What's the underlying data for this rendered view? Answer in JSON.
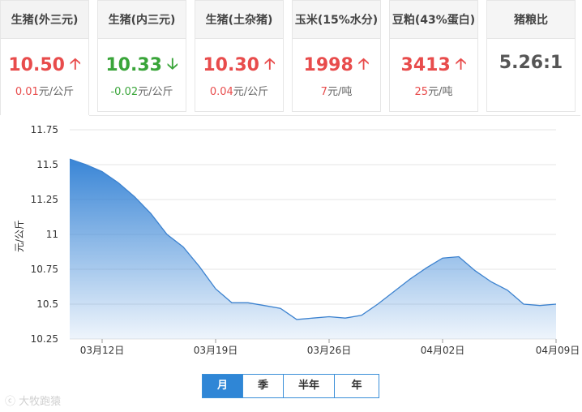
{
  "cards": [
    {
      "title": "生猪(外三元)",
      "price": "10.50",
      "direction": "up",
      "change_value": "0.01",
      "change_unit": "元/公斤"
    },
    {
      "title": "生猪(内三元)",
      "price": "10.33",
      "direction": "down",
      "change_value": "-0.02",
      "change_unit": "元/公斤"
    },
    {
      "title": "生猪(土杂猪)",
      "price": "10.30",
      "direction": "up",
      "change_value": "0.04",
      "change_unit": "元/公斤"
    },
    {
      "title": "玉米(15%水分)",
      "price": "1998",
      "direction": "up",
      "change_value": "7",
      "change_unit": "元/吨"
    },
    {
      "title": "豆粕(43%蛋白)",
      "price": "3413",
      "direction": "up",
      "change_value": "25",
      "change_unit": "元/吨"
    },
    {
      "title": "猪粮比",
      "price": "5.26:1",
      "direction": "none",
      "change_value": "",
      "change_unit": ""
    }
  ],
  "colors": {
    "up": "#e84c4c",
    "down": "#3aa53a",
    "area_top": "#2f7fd4",
    "line": "#3c82cf"
  },
  "icons": {
    "up": "arrow-up-icon",
    "down": "arrow-down-icon"
  },
  "chart_data": {
    "type": "area",
    "ylabel": "元/公斤",
    "ylim": [
      10.25,
      11.75
    ],
    "yticks": [
      "10.25",
      "10.5",
      "10.75",
      "11",
      "11.25",
      "11.5",
      "11.75"
    ],
    "x_tick_labels": [
      "03月12日",
      "03月19日",
      "03月26日",
      "04月02日",
      "04月09日"
    ],
    "x_tick_days": [
      2,
      9,
      16,
      23,
      30
    ],
    "x_range_days": [
      0,
      30
    ],
    "grid": "horizontal",
    "series": [
      {
        "days": [
          0,
          1,
          2,
          3,
          4,
          5,
          6,
          7,
          8,
          9,
          10,
          11,
          12,
          13,
          14,
          15,
          16,
          17,
          18,
          19,
          20,
          21,
          22,
          23,
          24,
          25,
          26,
          27,
          28,
          29,
          30
        ],
        "values": [
          11.54,
          11.5,
          11.45,
          11.37,
          11.27,
          11.15,
          11.0,
          10.91,
          10.77,
          10.61,
          10.51,
          10.51,
          10.49,
          10.47,
          10.39,
          10.4,
          10.41,
          10.4,
          10.42,
          10.5,
          10.59,
          10.68,
          10.76,
          10.83,
          10.84,
          10.74,
          10.66,
          10.6,
          10.5,
          10.49,
          10.5
        ]
      }
    ]
  },
  "period_tabs": [
    "月",
    "季",
    "半年",
    "年"
  ],
  "active_tab": "月",
  "watermark": "大牧跑猿"
}
